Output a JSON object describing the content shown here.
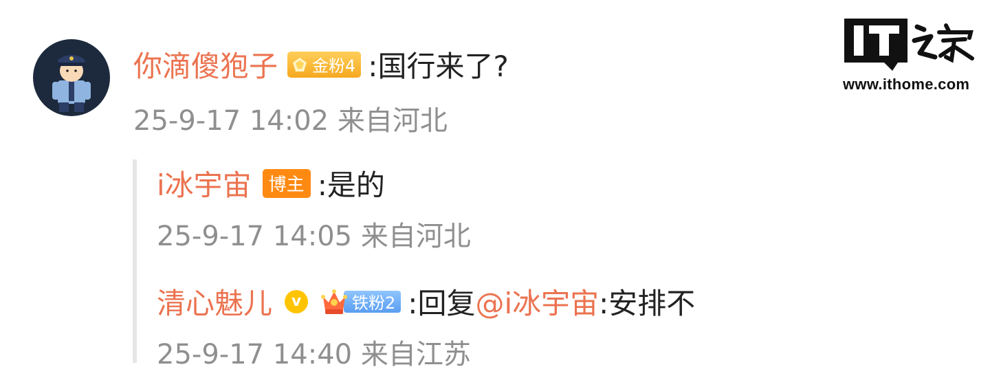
{
  "comment": {
    "username": "你滴傻狍子",
    "fan_badge": "金粉4",
    "text": ":国行来了?",
    "meta": "25-9-17 14:02 来自河北"
  },
  "replies": [
    {
      "username": "i冰宇宙",
      "badge": "博主",
      "text": ":是的",
      "meta": "25-9-17 14:05 来自河北"
    },
    {
      "username": "清心魅儿",
      "vip_icon": "v",
      "fan_badge": "铁粉2",
      "text_prefix": ":回复",
      "mention": "@i冰宇宙",
      "text_suffix": ":安排不",
      "meta": "25-9-17 14:40 来自江苏"
    }
  ],
  "watermark": {
    "logo_text": "IT之家",
    "url": "www.ithome.com"
  },
  "colors": {
    "username": "#eb7350",
    "meta": "#8f8f8f",
    "gold_badge": "#f6a820",
    "host_badge": "#ff8a12",
    "iron_badge": "#5a9df0"
  },
  "icons": [
    "police-avatar",
    "gold-gem-icon",
    "vip-icon",
    "crown-icon"
  ]
}
